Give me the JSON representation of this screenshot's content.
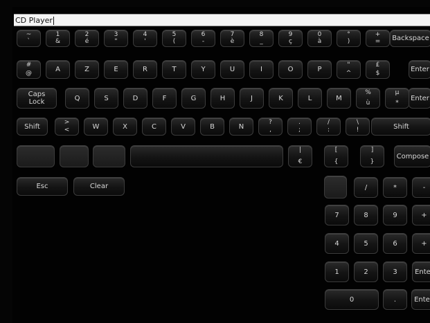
{
  "input": {
    "value": "CD Player"
  },
  "rows": {
    "number": [
      {
        "top": "~",
        "bot": "`"
      },
      {
        "top": "1",
        "bot": "&"
      },
      {
        "top": "2",
        "bot": "é"
      },
      {
        "top": "3",
        "bot": "\""
      },
      {
        "top": "4",
        "bot": "'"
      },
      {
        "top": "5",
        "bot": "("
      },
      {
        "top": "6",
        "bot": "-"
      },
      {
        "top": "7",
        "bot": "è"
      },
      {
        "top": "8",
        "bot": "_"
      },
      {
        "top": "9",
        "bot": "ç"
      },
      {
        "top": "0",
        "bot": "à"
      },
      {
        "top": "°",
        "bot": ")"
      },
      {
        "top": "+",
        "bot": "="
      }
    ],
    "backspace": "Backspace",
    "qwerty": [
      {
        "top": "#",
        "bot": "@"
      },
      {
        "label": "A"
      },
      {
        "label": "Z"
      },
      {
        "label": "E"
      },
      {
        "label": "R"
      },
      {
        "label": "T"
      },
      {
        "label": "Y"
      },
      {
        "label": "U"
      },
      {
        "label": "I"
      },
      {
        "label": "O"
      },
      {
        "label": "P"
      },
      {
        "top": "\"",
        "bot": "^"
      },
      {
        "top": "£",
        "bot": "$"
      }
    ],
    "enter1": "Enter",
    "caps": [
      "Caps",
      "Lock"
    ],
    "home": [
      {
        "label": "Q"
      },
      {
        "label": "S"
      },
      {
        "label": "D"
      },
      {
        "label": "F"
      },
      {
        "label": "G"
      },
      {
        "label": "H"
      },
      {
        "label": "J"
      },
      {
        "label": "K"
      },
      {
        "label": "L"
      },
      {
        "label": "M"
      },
      {
        "top": "%",
        "bot": "ù"
      },
      {
        "top": "µ",
        "bot": "*"
      }
    ],
    "enter2": "Enter",
    "shift_left": "Shift",
    "bottom": [
      {
        "top": ">",
        "bot": "<"
      },
      {
        "label": "W"
      },
      {
        "label": "X"
      },
      {
        "label": "C"
      },
      {
        "label": "V"
      },
      {
        "label": "B"
      },
      {
        "label": "N"
      },
      {
        "top": "?",
        "bot": ","
      },
      {
        "top": ".",
        "bot": ";"
      },
      {
        "top": "/",
        "bot": ":"
      },
      {
        "top": "\\",
        "bot": "!"
      }
    ],
    "shift_right": "Shift",
    "special": [
      {
        "top": "|",
        "bot": "€"
      },
      {
        "top": "[",
        "bot": "{"
      },
      {
        "top": "]",
        "bot": "}"
      }
    ],
    "compose": "Compose"
  },
  "controls": {
    "esc": "Esc",
    "clear": "Clear"
  },
  "numpad": {
    "row1": [
      "/",
      "*",
      "-"
    ],
    "row2": [
      "7",
      "8",
      "9",
      "+"
    ],
    "row3": [
      "4",
      "5",
      "6",
      "+"
    ],
    "row4": [
      "1",
      "2",
      "3",
      "Enter"
    ],
    "row5": [
      "0",
      ".",
      "Enter"
    ]
  }
}
